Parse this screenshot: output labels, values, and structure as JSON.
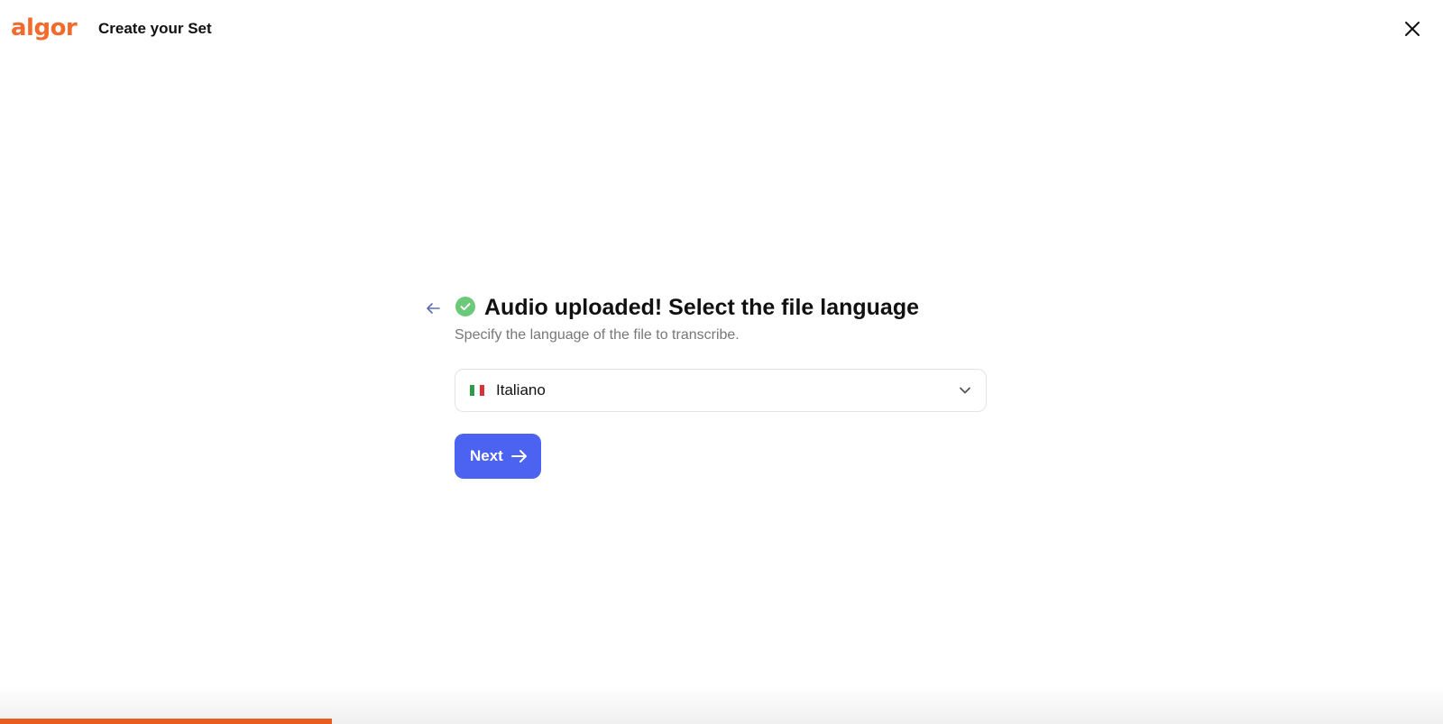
{
  "header": {
    "logo_text": "algor",
    "title": "Create your Set",
    "close_icon": "close-icon"
  },
  "main": {
    "back_icon": "arrow-left-icon",
    "status_icon": "check-circle-icon",
    "heading": "Audio uploaded! Select the file language",
    "subheading": "Specify the language of the file to transcribe.",
    "language_select": {
      "selected_value": "Italiano",
      "flag_icon": "italy-flag-icon",
      "chevron_icon": "chevron-down-icon"
    },
    "next_button": {
      "label": "Next",
      "icon": "arrow-right-icon"
    }
  },
  "progress": {
    "value": 0.23
  },
  "colors": {
    "brand_orange": "#f26a2e",
    "progress_orange": "#e85c1f",
    "primary_blue": "#4b63f0",
    "success_green": "#6cc97a",
    "back_arrow": "#5a6bb8"
  }
}
